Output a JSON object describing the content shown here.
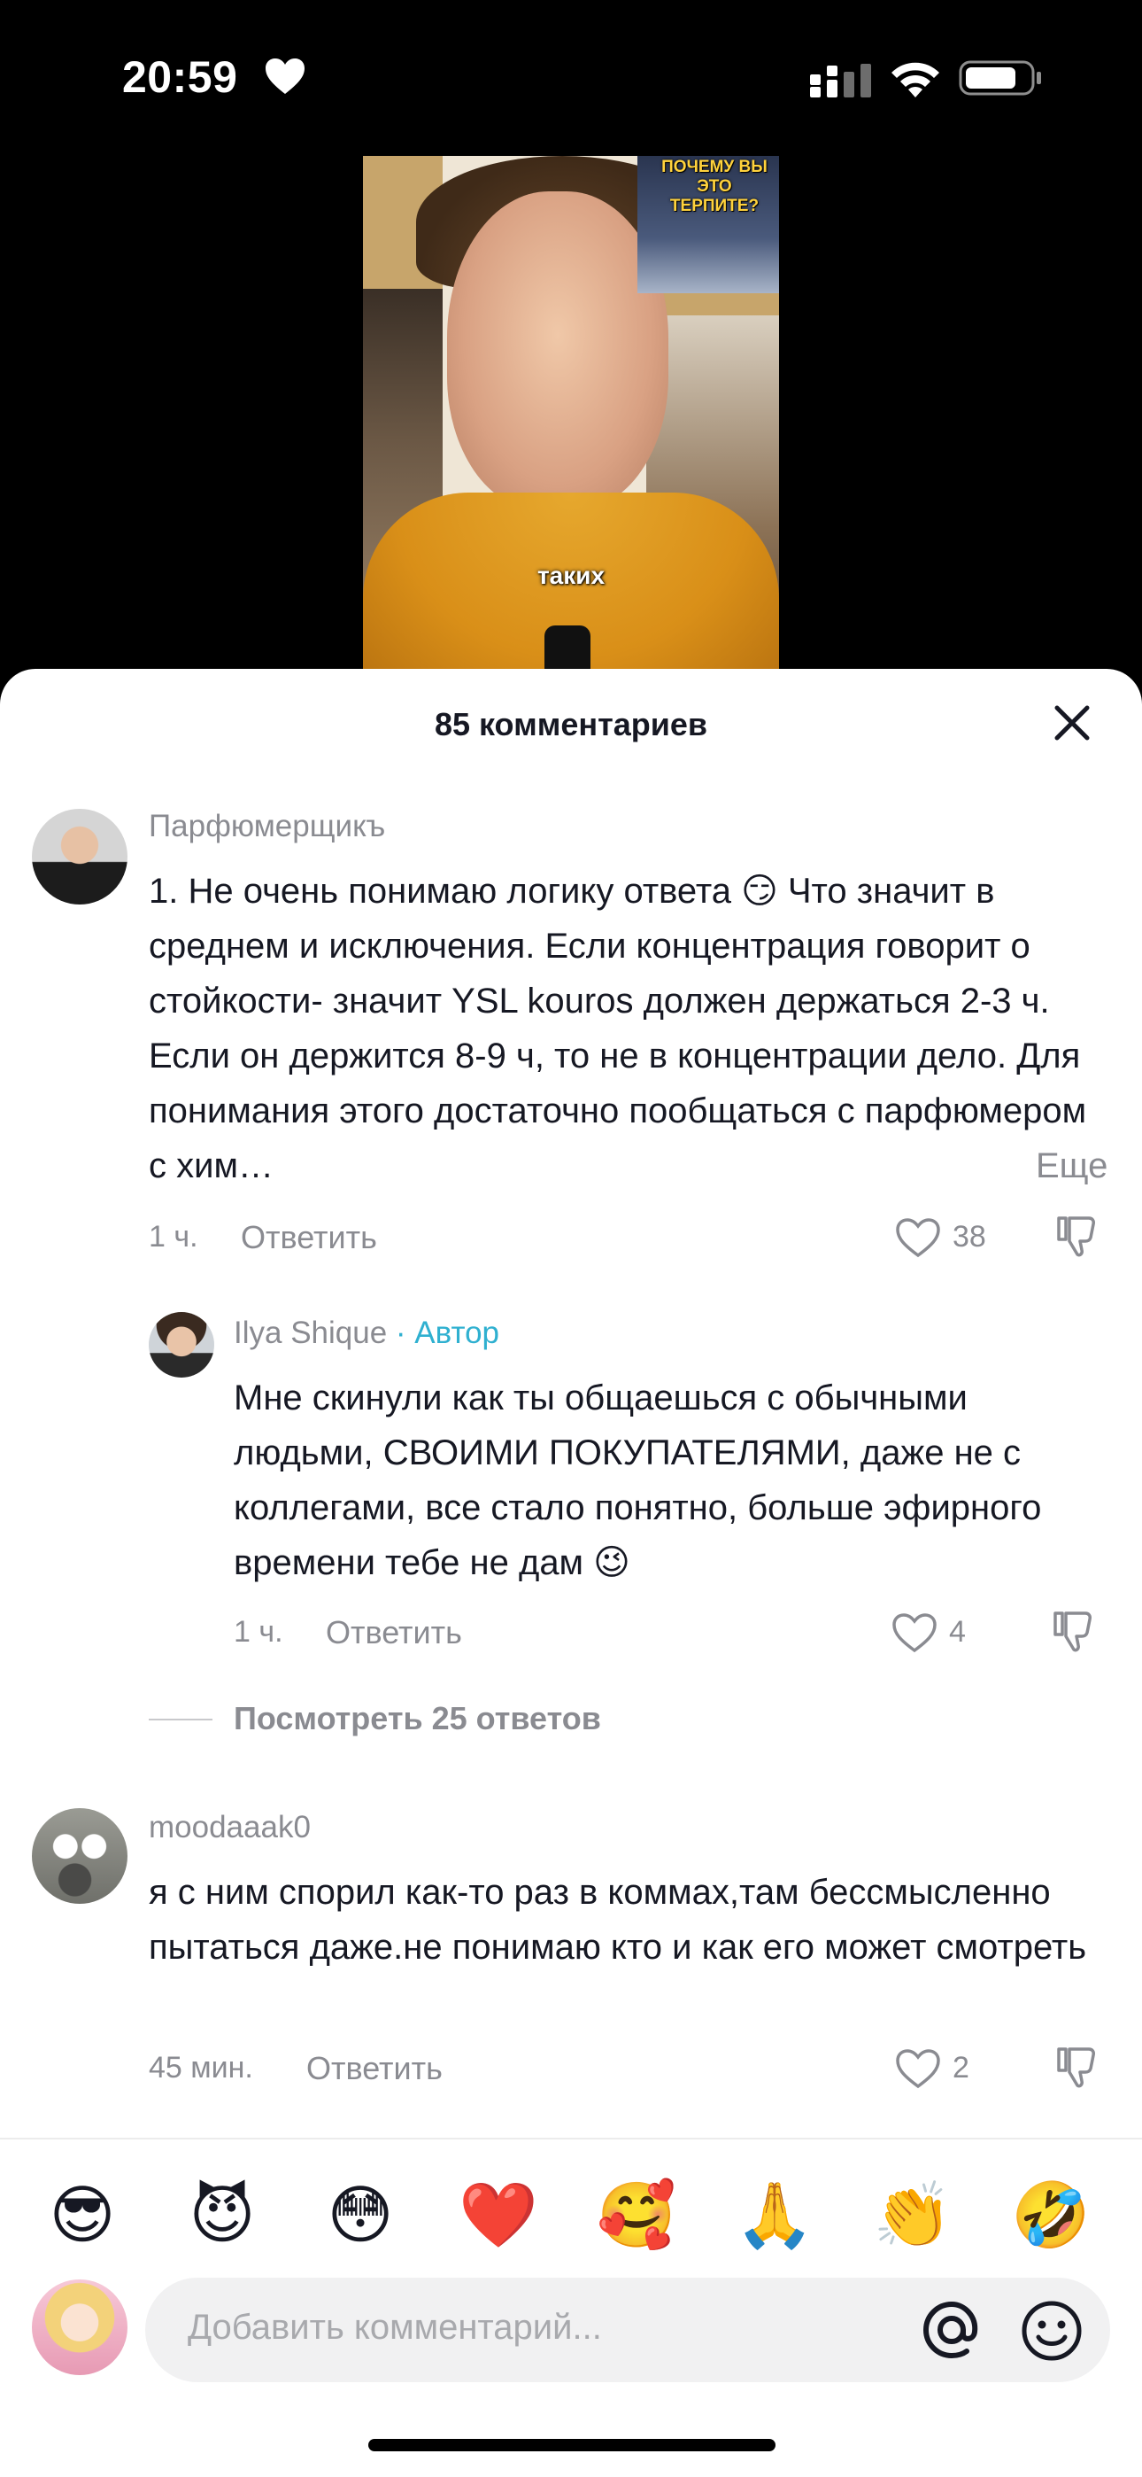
{
  "status_bar": {
    "time": "20:59"
  },
  "video": {
    "thumb_text": "ПОЧЕМУ ВЫ ЭТО ТЕРПИТЕ?",
    "caption": "таких"
  },
  "sheet": {
    "title": "85 комментариев",
    "comments": [
      {
        "username": "Парфюмерщикъ",
        "text": "1. Не очень понимаю логику ответа 😏 Что значит в среднем и исключения. Если концентрация говорит о стойкости- значит YSL kouros должен держаться 2-3 ч. Если он держится 8-9 ч, то не в концентрации дело. Для понимания этого достаточно пообщаться с парфюмером с хим…",
        "more": "Еще",
        "time": "1 ч.",
        "reply": "Ответить",
        "likes": "38"
      },
      {
        "username": "Ilya Shique",
        "badge": "· Автор",
        "text": "Мне скинули как ты общаешься с обычными людьми, СВОИМИ ПОКУПАТЕЛЯМИ, даже не с коллегами, все стало понятно, больше эфирного времени тебе не дам 😉",
        "time": "1 ч.",
        "reply": "Ответить",
        "likes": "4"
      },
      {
        "username": "moodaaak0",
        "text": "я с ним спорил как-то раз в коммах,там бессмысленно пытаться даже.не понимаю кто и как его может смотреть",
        "time": "45 мин.",
        "reply": "Ответить",
        "likes": "2"
      }
    ],
    "view_replies": "Посмотреть 25 ответов"
  },
  "emoji_bar": [
    "😎",
    "😈",
    "😳",
    "❤️",
    "🥰",
    "🙏",
    "👏",
    "🤣"
  ],
  "input": {
    "placeholder": "Добавить комментарий..."
  },
  "colors": {
    "accent_author": "#2fb0d0",
    "muted": "#8a8b91",
    "text": "#161823"
  }
}
